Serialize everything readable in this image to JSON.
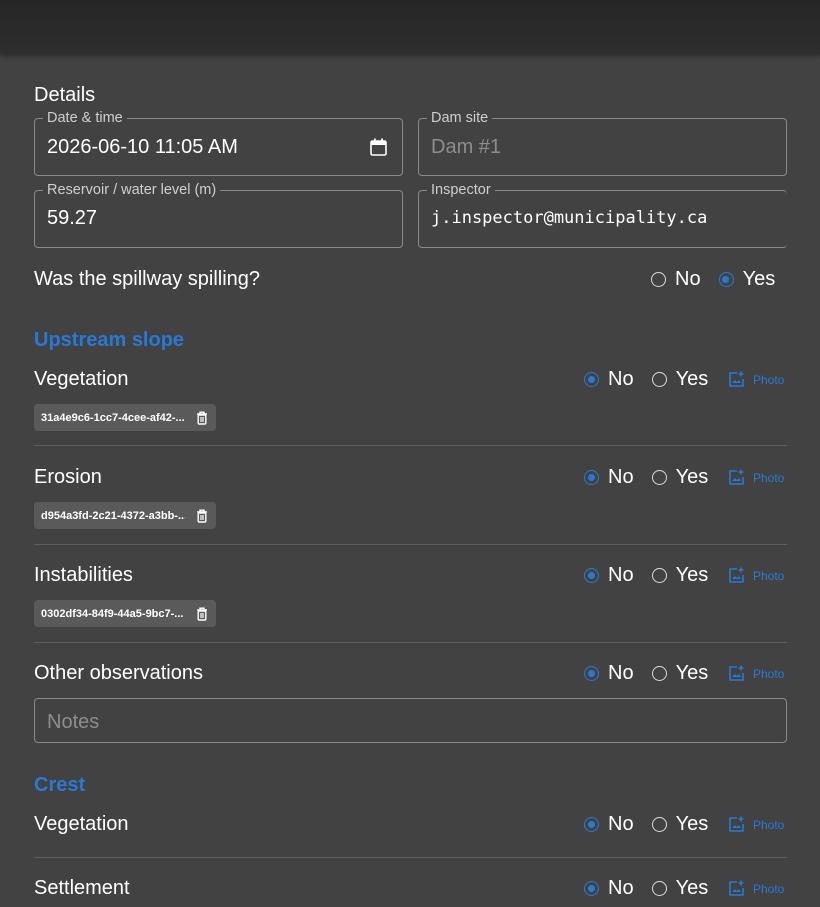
{
  "details": {
    "title": "Details",
    "date_time": {
      "label": "Date & time",
      "value": "2026-06-10 11:05 AM"
    },
    "dam_site": {
      "label": "Dam site",
      "placeholder": "Dam #1"
    },
    "water_level": {
      "label": "Reservoir / water level (m)",
      "value": "59.27"
    },
    "inspector": {
      "label": "Inspector",
      "value": "j.inspector@municipality.ca"
    },
    "spillway": {
      "question": "Was the spillway spilling?",
      "no_label": "No",
      "yes_label": "Yes",
      "selected": "Yes"
    }
  },
  "upstream_slope": {
    "title": "Upstream slope",
    "items": [
      {
        "label": "Vegetation",
        "no_label": "No",
        "yes_label": "Yes",
        "selected": "No",
        "photo_label": "Photo",
        "attachment": "31a4e9c6-1cc7-4cee-af42-..."
      },
      {
        "label": "Erosion",
        "no_label": "No",
        "yes_label": "Yes",
        "selected": "No",
        "photo_label": "Photo",
        "attachment": "d954a3fd-2c21-4372-a3bb-..."
      },
      {
        "label": "Instabilities",
        "no_label": "No",
        "yes_label": "Yes",
        "selected": "No",
        "photo_label": "Photo",
        "attachment": "0302df34-84f9-44a5-9bc7-..."
      },
      {
        "label": "Other observations",
        "no_label": "No",
        "yes_label": "Yes",
        "selected": "No",
        "photo_label": "Photo",
        "notes_placeholder": "Notes"
      }
    ]
  },
  "crest": {
    "title": "Crest",
    "items": [
      {
        "label": "Vegetation",
        "no_label": "No",
        "yes_label": "Yes",
        "selected": "No",
        "photo_label": "Photo"
      },
      {
        "label": "Settlement",
        "no_label": "No",
        "yes_label": "Yes",
        "selected": "No",
        "photo_label": "Photo"
      }
    ]
  },
  "colors": {
    "accent": "#2979d4",
    "background": "#424242",
    "topbar": "#2b2b2b"
  },
  "icons": {
    "calendar": "calendar-icon",
    "photo": "add-photo-icon",
    "delete": "trash-icon"
  }
}
